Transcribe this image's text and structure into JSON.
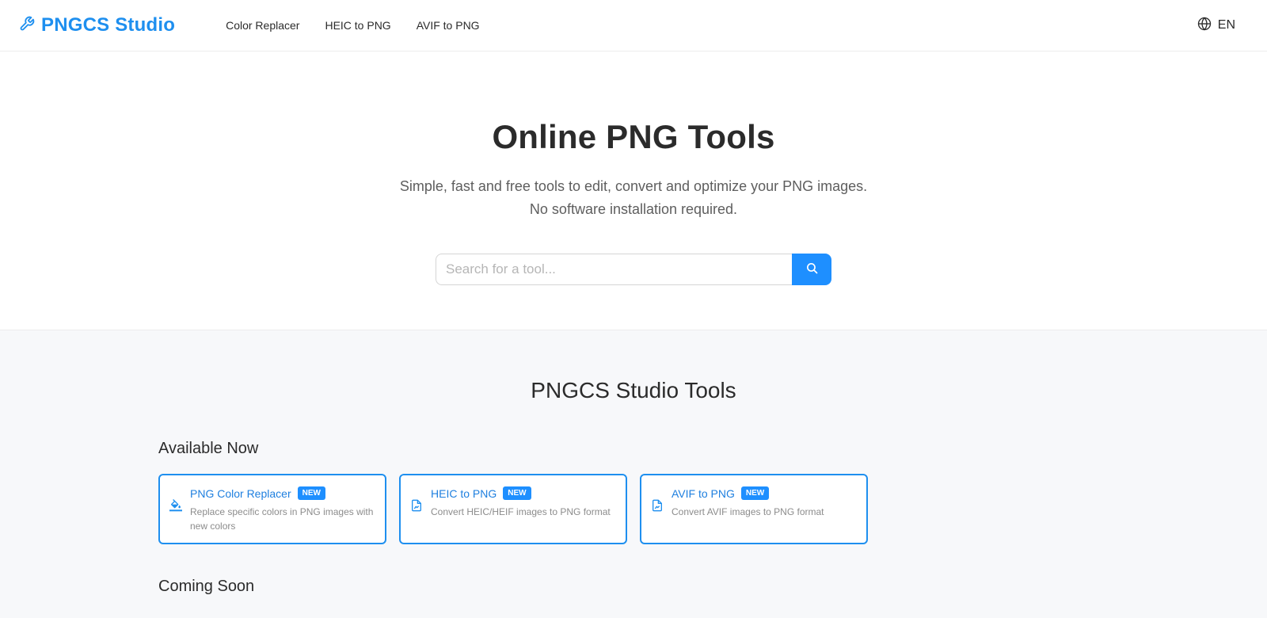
{
  "brand": {
    "name": "PNGCS Studio",
    "icon": "wrench-icon",
    "color": "#1e8fef"
  },
  "nav": [
    {
      "label": "Color Replacer"
    },
    {
      "label": "HEIC to PNG"
    },
    {
      "label": "AVIF to PNG"
    }
  ],
  "language": {
    "label": "EN",
    "icon": "globe-icon"
  },
  "hero": {
    "title": "Online PNG Tools",
    "subtitle_line1": "Simple, fast and free tools to edit, convert and optimize your PNG images.",
    "subtitle_line2": "No software installation required."
  },
  "search": {
    "placeholder": "Search for a tool...",
    "button_icon": "search-icon",
    "accent": "#1e8fff"
  },
  "tools": {
    "title": "PNGCS Studio Tools",
    "available_title": "Available Now",
    "coming_title": "Coming Soon",
    "cards": [
      {
        "name": "PNG Color Replacer",
        "badge": "NEW",
        "desc": "Replace specific colors in PNG images with new colors",
        "icon": "paint-bucket-icon"
      },
      {
        "name": "HEIC to PNG",
        "badge": "NEW",
        "desc": "Convert HEIC/HEIF images to PNG format",
        "icon": "file-image-icon"
      },
      {
        "name": "AVIF to PNG",
        "badge": "NEW",
        "desc": "Convert AVIF images to PNG format",
        "icon": "file-image-icon"
      }
    ]
  }
}
